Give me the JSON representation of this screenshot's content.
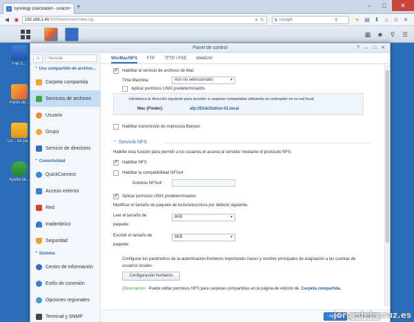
{
  "browser": {
    "tab_title": "Synology DiskStation - DiskSta...",
    "url_host": "192.168.1.40",
    "url_path": ":5000/webman/index.cgi",
    "search_placeholder": "Google",
    "search_engine_glyph": "g"
  },
  "desktop": {
    "icons": [
      {
        "label": "File S..."
      },
      {
        "label": "Panel de..."
      },
      {
        "label": "Ce... de pa..."
      },
      {
        "label": "Ayuda de..."
      }
    ]
  },
  "window": {
    "title": "Panel de control",
    "controls": {
      "help": "?",
      "minimize": "–",
      "maximize": "□",
      "close": "✕"
    }
  },
  "sidebar": {
    "search_placeholder": "Buscar",
    "sections": [
      {
        "title": "Uso compartido de archivo..."
      },
      {
        "title": "Conectividad"
      },
      {
        "title": "Sistema"
      }
    ],
    "items": [
      {
        "label": "Carpeta compartida",
        "icon": "shared-folder-icon",
        "color": "#f0a830"
      },
      {
        "label": "Servicios de archivos",
        "icon": "file-services-icon",
        "color": "#3aa843"
      },
      {
        "label": "Usuario",
        "icon": "user-icon",
        "color": "#f08a2a"
      },
      {
        "label": "Grupo",
        "icon": "group-icon",
        "color": "#f0a830"
      },
      {
        "label": "Servicio de directorio",
        "icon": "directory-icon",
        "color": "#2f6fc0"
      },
      {
        "label": "QuickConnect",
        "icon": "quickconnect-icon",
        "color": "#2f8fd8"
      },
      {
        "label": "Acceso externo",
        "icon": "external-access-icon",
        "color": "#3a7fd0"
      },
      {
        "label": "Red",
        "icon": "network-icon",
        "color": "#d8403a"
      },
      {
        "label": "Inalámbrico",
        "icon": "wireless-icon",
        "color": "#2f7fd0"
      },
      {
        "label": "Seguridad",
        "icon": "security-icon",
        "color": "#e8a22a"
      },
      {
        "label": "Centro de información",
        "icon": "info-icon",
        "color": "#2f6fc0"
      },
      {
        "label": "Estilo de conexión",
        "icon": "login-style-icon",
        "color": "#3a7fd0"
      },
      {
        "label": "Opciones regionales",
        "icon": "regional-icon",
        "color": "#3aa0d8"
      },
      {
        "label": "Terminal y SNMP",
        "icon": "terminal-icon",
        "color": "#444"
      }
    ]
  },
  "tabs": [
    {
      "label": "Win/Mac/NFS",
      "active": true
    },
    {
      "label": "FTP",
      "active": false
    },
    {
      "label": "TFTP / PXE",
      "active": false
    },
    {
      "label": "WebDAV",
      "active": false
    }
  ],
  "mac": {
    "enable_label": "Habilitar el servicio de archivos de Mac",
    "enable_checked": true,
    "time_machine_label": "Time Machine:",
    "time_machine_value": "Aún no seleccionado",
    "unix_label": "Aplicar permisos UNIX predeterminados",
    "unix_checked": false,
    "info_text": "Introduzca la dirección siguiente para acceder a carpetas compartidas utilizando un ordenador en su red local:",
    "finder_label": "Mac (Finder):",
    "finder_value": "afp://DiskStation-01.local",
    "bonjour_label": "Habilitar transmisión de impresora Bonjour",
    "bonjour_checked": false
  },
  "nfs": {
    "section_title": "Servicio NFS",
    "description": "Habilite esta función para permitir a los usuarios el acceso al servidor mediante el protocolo NFS.",
    "enable_label": "Habilitar NFS",
    "enable_checked": true,
    "nfsv4_label": "Habilitar la compatibilidad NFSv4",
    "nfsv4_checked": false,
    "domain_label": "Dominio NFSv4:",
    "domain_value": "",
    "unix_label": "Aplicar permisos UNIX predeterminados",
    "unix_checked": true,
    "packet_text": "Modificar el tamaño de paquete de lectura/escritura por defecto siguiente.",
    "read_label_1": "Leer el tamaño de",
    "read_label_2": "paquete:",
    "read_value": "8KB",
    "write_label_1": "Escribir el tamaño de",
    "write_label_2": "paquete:",
    "write_value": "8KB",
    "kerberos_text_1": "Configurar los parámetros de la autenticación Kerberos importando claves y nombre principales de asignación a las cuentas de",
    "kerberos_text_2": "usuarios locales.",
    "kerberos_button": "Configuración Kerberos",
    "observation_label": "Observación:",
    "observation_text": "Puede editar permisos NFS para carpetas compartidas en la página de edición de",
    "observation_link": "Carpeta compartida."
  },
  "footer": {
    "apply": "Aplicar",
    "reset": "Restablecer"
  },
  "watermark": "jorgedelacruz.es"
}
